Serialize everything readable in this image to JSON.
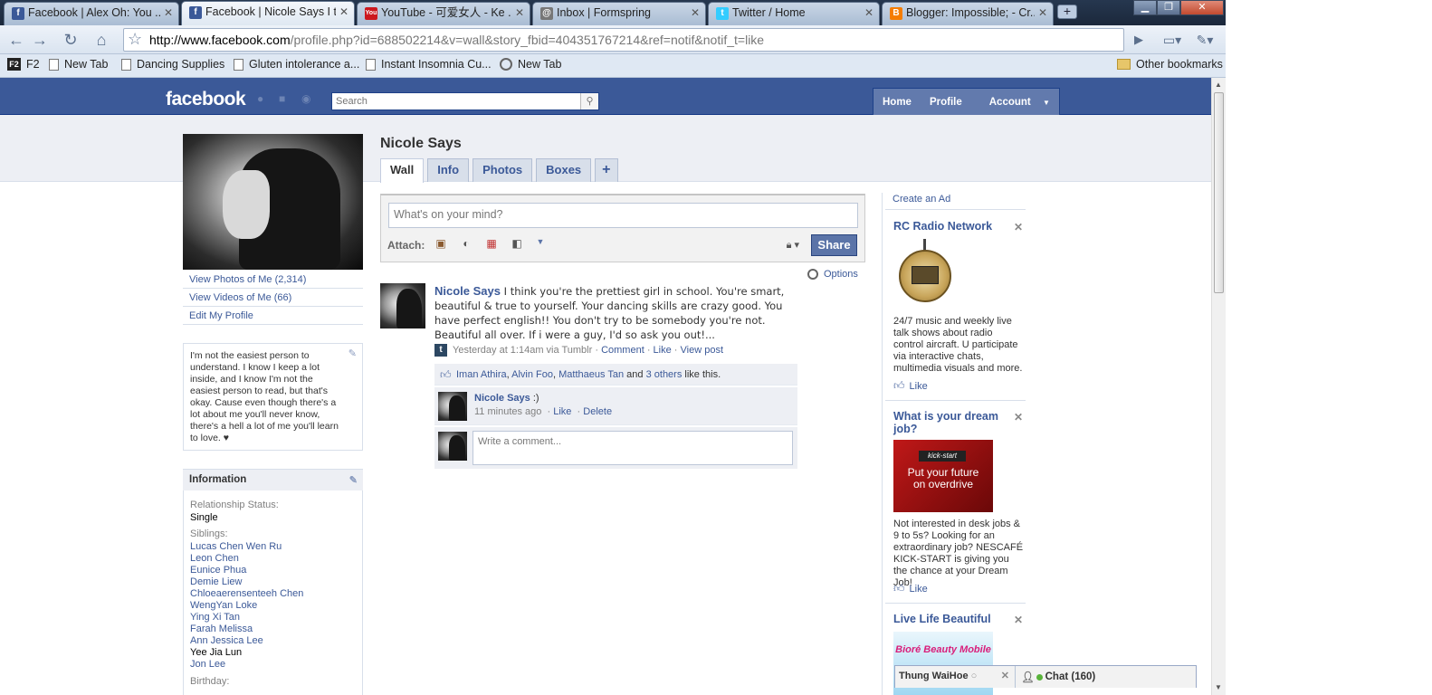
{
  "browser": {
    "tabs": [
      {
        "favicon": "f",
        "favicon_color": "#3b5998",
        "title": "Facebook | Alex Oh: You ..."
      },
      {
        "favicon": "f",
        "favicon_color": "#3b5998",
        "title": "Facebook | Nicole Says I t..."
      },
      {
        "favicon": "You",
        "favicon_color": "#cc181e",
        "title": "YouTube - 可爱女人 - Ke ..."
      },
      {
        "favicon": "@",
        "favicon_color": "#666666",
        "title": "Inbox | Formspring"
      },
      {
        "favicon": "t",
        "favicon_color": "#33ccff",
        "title": "Twitter / Home"
      },
      {
        "favicon": "B",
        "favicon_color": "#f57d00",
        "title": "Blogger: Impossible; - Cr..."
      }
    ],
    "url_host": "http://www.facebook.com",
    "url_path": "/profile.php?id=688502214&v=wall&story_fbid=404351767214&ref=notif&notif_t=like",
    "bookmarks": [
      "F2",
      "New Tab",
      "Dancing Supplies",
      "Gluten intolerance a...",
      "Instant Insomnia Cu...",
      "New Tab"
    ],
    "other_bookmarks": "Other bookmarks"
  },
  "fb": {
    "logo": "facebook",
    "search_placeholder": "Search",
    "nav": {
      "home": "Home",
      "profile": "Profile",
      "account": "Account"
    }
  },
  "profile": {
    "name": "Nicole Says",
    "tabs": [
      "Wall",
      "Info",
      "Photos",
      "Boxes",
      "+"
    ],
    "links": [
      "View Photos of Me (2,314)",
      "View Videos of Me (66)",
      "Edit My Profile"
    ],
    "about": "I'm not the easiest person to understand. I know I keep a lot inside, and I know I'm not the easiest person to read, but that's okay. Cause even though there's a lot about me you'll never know, there's a hell a lot of me you'll learn to love. ♥",
    "information": {
      "heading": "Information",
      "relationship_label": "Relationship Status:",
      "relationship_value": "Single",
      "siblings_label": "Siblings:",
      "siblings": [
        "Lucas Chen Wen Ru",
        "Leon Chen",
        "Eunice Phua",
        "Demie Liew",
        "Chloeaerensenteeh Chen",
        "WengYan Loke",
        "Ying Xi Tan",
        "Farah Melissa",
        "Ann Jessica Lee",
        "Yee Jia Lun",
        "Jon Lee"
      ],
      "birthday_label": "Birthday:"
    }
  },
  "composer": {
    "placeholder": "What's on your mind?",
    "attach_label": "Attach:",
    "share_label": "Share"
  },
  "story": {
    "options_label": "Options",
    "author": "Nicole Says",
    "text": "I think you're the prettiest girl in school. You're smart, beautiful & true to yourself. Your dancing skills are crazy good. You have perfect english!! You don't try to be somebody you're not. Beautiful all over. If i were a guy, I'd so ask you out!...",
    "meta_time": "Yesterday at 1:14am via Tumblr",
    "meta_comment": "Comment",
    "meta_like": "Like",
    "meta_view": "View post",
    "likes": {
      "names": [
        "Iman Athira",
        "Alvin Foo",
        "Matthaeus Tan"
      ],
      "and_text": "and",
      "others": "3 others",
      "suffix": "like this."
    },
    "comment": {
      "author": "Nicole Says",
      "text": ":)",
      "time": "11 minutes ago",
      "like": "Like",
      "delete": "Delete"
    },
    "write_placeholder": "Write a comment..."
  },
  "ads": {
    "create_ad": "Create an Ad",
    "items": [
      {
        "title": "RC Radio Network",
        "text": "24/7 music and weekly live talk shows about radio control aircraft. U participate via interactive chats, multimedia visuals and more.",
        "like": "Like"
      },
      {
        "title": "What is your dream job?",
        "text": "Not interested in desk jobs & 9 to 5s? Looking for an extraordinary job? NESCAFÉ KICK-START is giving you the chance at your Dream Job!",
        "like": "Like",
        "image_brand": "kick-start",
        "image_text": "Put your future on overdrive"
      },
      {
        "title": "Live Life Beautiful",
        "image_text": "Bioré Beauty Mobile"
      }
    ]
  },
  "chat": {
    "buddy": "Thung WaiHoe",
    "label": "Chat (160)"
  }
}
